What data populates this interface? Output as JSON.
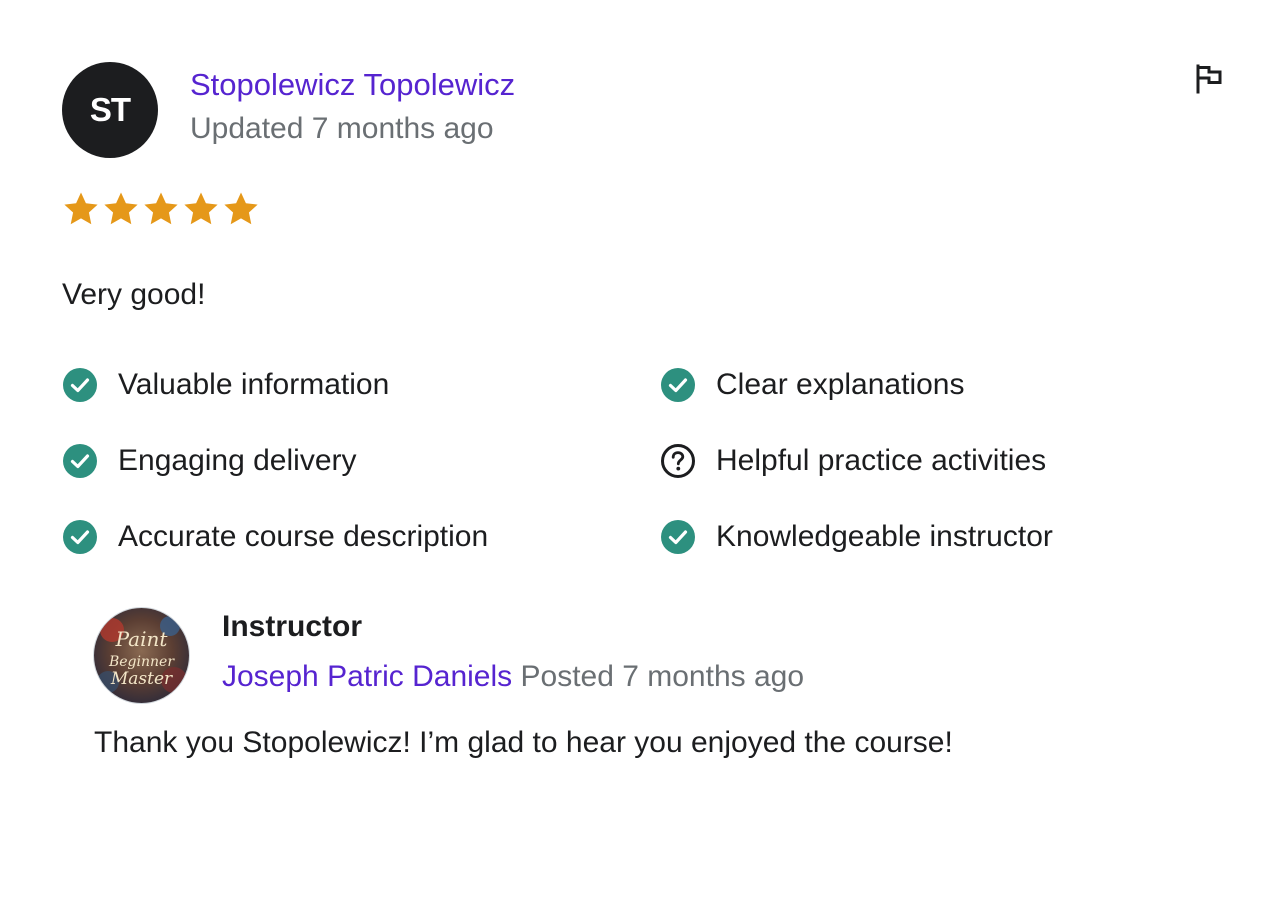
{
  "review": {
    "avatar_initials": "ST",
    "reviewer_name": "Stopolewicz Topolewicz",
    "updated": "Updated 7 months ago",
    "rating": 5,
    "rating_max": 5,
    "star_color": "#e59819",
    "text": "Very good!",
    "report_icon": "flag-icon"
  },
  "feedback": [
    {
      "label": "Valuable information",
      "icon": "check-circle-icon",
      "status": "yes"
    },
    {
      "label": "Clear explanations",
      "icon": "check-circle-icon",
      "status": "yes"
    },
    {
      "label": "Engaging delivery",
      "icon": "check-circle-icon",
      "status": "yes"
    },
    {
      "label": "Helpful practice activities",
      "icon": "question-circle-icon",
      "status": "unsure"
    },
    {
      "label": "Accurate course description",
      "icon": "check-circle-icon",
      "status": "yes"
    },
    {
      "label": "Knowledgeable instructor",
      "icon": "check-circle-icon",
      "status": "yes"
    }
  ],
  "instructor_response": {
    "label": "Instructor",
    "name": "Joseph Patric Daniels",
    "posted": "Posted 7 months ago",
    "avatar_text": [
      "Paint",
      "Beginner",
      "Master"
    ],
    "text": "Thank you Stopolewicz! I’m glad to hear you enjoyed the course!"
  },
  "colors": {
    "accent": "#5624d0",
    "muted": "#6a6f73",
    "check": "#2d907f",
    "text": "#1c1d1f"
  }
}
